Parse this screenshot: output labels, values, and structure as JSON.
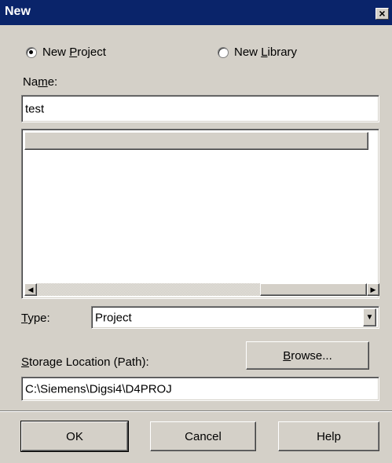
{
  "window": {
    "title": "New",
    "close_glyph": "×"
  },
  "project_options": {
    "new_project": {
      "pre": "New ",
      "mnemonic": "P",
      "post": "roject",
      "selected": true
    },
    "new_library": {
      "pre": "New ",
      "mnemonic": "L",
      "post": "ibrary",
      "selected": false
    }
  },
  "name_field": {
    "label_pre": "Na",
    "label_mnemonic": "m",
    "label_post": "e:",
    "value": "test"
  },
  "list": {
    "header": "",
    "items": []
  },
  "scrollbar": {
    "left_glyph": "◀",
    "right_glyph": "▶"
  },
  "type_field": {
    "label_mnemonic": "T",
    "label_post": "ype:",
    "value": "Project",
    "dropdown_glyph": "▼"
  },
  "storage": {
    "label_mnemonic": "S",
    "label_post": "torage Location (Path):",
    "path": "C:\\Siemens\\Digsi4\\D4PROJ",
    "browse_mnemonic": "B",
    "browse_post": "rowse..."
  },
  "buttons": {
    "ok": "OK",
    "cancel": "Cancel",
    "help": "Help"
  }
}
